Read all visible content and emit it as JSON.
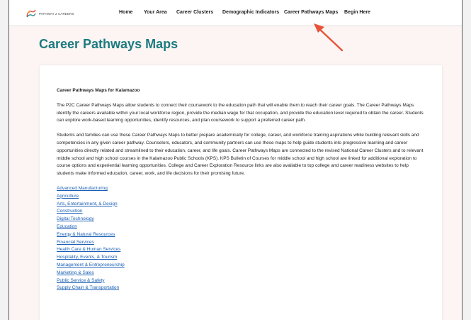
{
  "header": {
    "logo_text": "PATHWAY 2 CAREERS",
    "nav": [
      "Home",
      "Your Area",
      "Career Clusters",
      "Demographic Indicators",
      "Career Pathways Maps",
      "Begin Here"
    ]
  },
  "page": {
    "title": "Career Pathways Maps",
    "section_heading": "Career Pathways Maps for Kalamazoo",
    "paragraphs": [
      "The P2C Career Pathways Maps allow students to connect their coursework to the education path that will enable them to reach their career goals. The Career Pathways Maps identify the careers available within your local workforce region, provide the median wage for that occupation, and provide the education level required to obtain the career. Students can explore work-based learning opportunities, identify resources, and plan coursework to support a preferred career path.",
      "Students and families can use these Career Pathways Maps to better prepare academically for college, career, and workforce training aspirations while building relevant skills and competencies in any given career pathway. Counselors, educators, and community partners can use these maps to help guide students into progressive learning and career opportunities directly related and streamlined to their education, career, and life goals. Career Pathways Maps are connected to the revised National Career Clusters and to relevant middle school and high school courses in the Kalamazoo Public Schools (KPS). KPS Bulletin of Courses for middle school and high school are linked for additional exploration to course options and experiential learning opportunities. College and Career Exploration Resource links are also available to top college and career readiness websites to help students make informed education, career, work, and life decisions for their promising future."
    ],
    "cluster_links": [
      "Advanced Manufacturing",
      "Agriculture",
      "Arts, Entertainment, & Design",
      "Construction",
      "Digital Technology",
      "Education",
      "Energy & Natural Resources",
      "Financial Services",
      "Health Care & Human Services",
      "Hospitality, Events, & Tourism",
      "Management & Entrepreneurship",
      "Marketing & Sales",
      "Public Service & Safety",
      "Supply Chain & Transportation"
    ]
  },
  "colors": {
    "accent": "#1c7a80",
    "link": "#1a5fb4",
    "arrow": "#e8533a",
    "page_bg": "#fcf5f3"
  }
}
